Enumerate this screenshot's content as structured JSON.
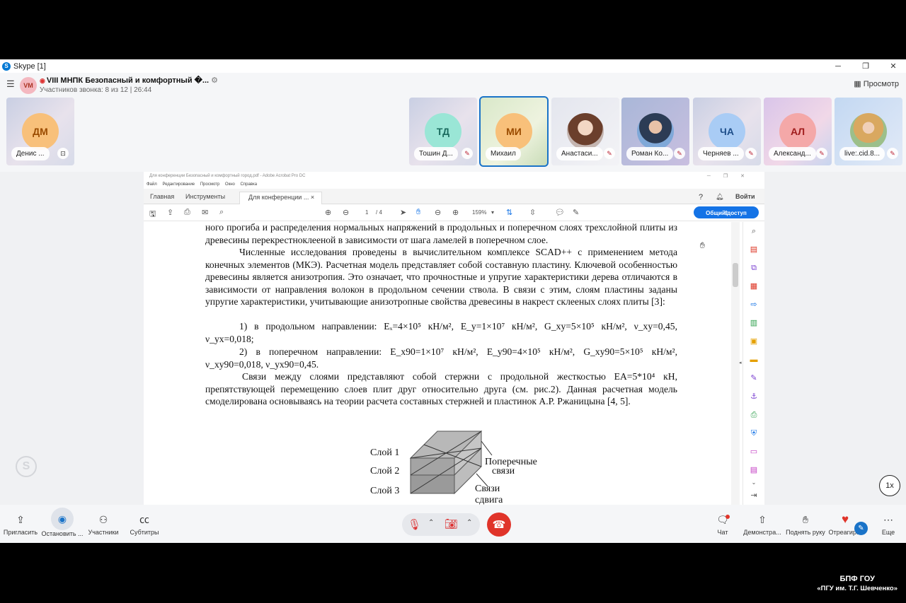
{
  "window": {
    "title": "Skype [1]",
    "minimize": "─",
    "maximize": "❐",
    "close": "✕"
  },
  "call": {
    "initials": "VM",
    "title": "VIII МНПК Безопасный и комфортный �...",
    "info": "Участников звонка: 8 из 12 | 26:44",
    "view_label": "Просмотр"
  },
  "participants": [
    {
      "initials": "ДМ",
      "name": "Денис ...",
      "color": "#f8c07a",
      "text": "#9a4b00",
      "avatar": "initials"
    },
    {
      "initials": "ТД",
      "name": "Тошин Д...",
      "color": "#9ae6d6",
      "text": "#1a6b5e",
      "avatar": "initials"
    },
    {
      "initials": "МИ",
      "name": "Михаил",
      "color": "#f8c07a",
      "text": "#9a4b00",
      "avatar": "initials"
    },
    {
      "initials": "",
      "name": "Анастаси...",
      "color": "#7b5b4a",
      "text": "#fff",
      "avatar": "photo"
    },
    {
      "initials": "",
      "name": "Роман Ко...",
      "color": "#3d6fa8",
      "text": "#fff",
      "avatar": "photo"
    },
    {
      "initials": "ЧА",
      "name": "Черняев ...",
      "color": "#a9ccf5",
      "text": "#1f4f8a",
      "avatar": "initials"
    },
    {
      "initials": "АЛ",
      "name": "Александ...",
      "color": "#f4a8a8",
      "text": "#a01c1c",
      "avatar": "initials"
    },
    {
      "initials": "",
      "name": "live:.cid.8...",
      "color": "#d8b070",
      "text": "#fff",
      "avatar": "photo"
    }
  ],
  "acrobat": {
    "title": "Для конференции Безопасный и комфортный город.pdf - Adobe Acrobat Pro DC",
    "menu": [
      "Файл",
      "Редактирование",
      "Просмотр",
      "Окно",
      "Справка"
    ],
    "tabs": {
      "home": "Главная",
      "tools": "Инструменты",
      "doc": "Для конференции ...",
      "close": "×"
    },
    "signin": "Войти",
    "page_current": "1",
    "page_total": "/ 4",
    "zoom": "159%",
    "share": "Общий доступ"
  },
  "document": {
    "p1": "ного прогиба и распределения нормальных напряжений в продольных и поперечном слоях трехслойной плиты из древесины перекрестноклееной в зависимости от шага ламелей в поперечном слое.",
    "p2": "Численные исследования проведены в вычислительном комплексе SCAD++ с применением метода конечных элементов (МКЭ). Расчетная модель представляет собой составную пластину. Ключевой особенностью древесины является анизотропия. Это означает, что прочностные и упругие характеристики дерева отличаются в зависимости от направления волокон в продольном сечении ствола. В связи с этим, слоям пластины заданы упругие характеристики, учитывающие анизотропные свойства древесины в накрест склееных слоях плиты [3]:",
    "item1": "1)     в продольном направлении: Eₓ=4×10⁵ кН/м², E_y=1×10⁷ кН/м², G_xy=5×10⁵ кН/м², ν_xy=0,45, ν_yx=0,018;",
    "item2": "2)     в поперечном направлении: E_x90=1×10⁷ кН/м², E_y90=4×10⁵ кН/м², G_xy90=5×10⁵ кН/м², ν_xy90=0,018, ν_yx90=0,45.",
    "p3": "Связи между слоями представляют собой стержни с продольной жесткостью EA=5*10⁴ кН, препятствующей перемещению слоев плит друг относительно друга (см. рис.2). Данная расчетная модель смоделирована основываясь на теории расчета составных стержней и пластинок А.Р. Ржаницына [4, 5].",
    "fig": {
      "layer1": "Слой 1",
      "layer2": "Слой 2",
      "layer3": "Слой 3",
      "transverse": "Поперечные",
      "links": "связи",
      "shear1": "Связи",
      "shear2": "сдвига"
    }
  },
  "toolbar": {
    "invite": "Пригласить",
    "stop": "Остановить ...",
    "participants": "Участники",
    "subtitles": "Субтитры",
    "chat": "Чат",
    "demo": "Демонстра...",
    "raise": "Поднять руку",
    "react": "Отреагир...",
    "more": "Еще"
  },
  "speed": "1x",
  "caption": {
    "line1": "БПФ ГОУ",
    "line2": "«ПГУ им. Т.Г. Шевченко»"
  }
}
